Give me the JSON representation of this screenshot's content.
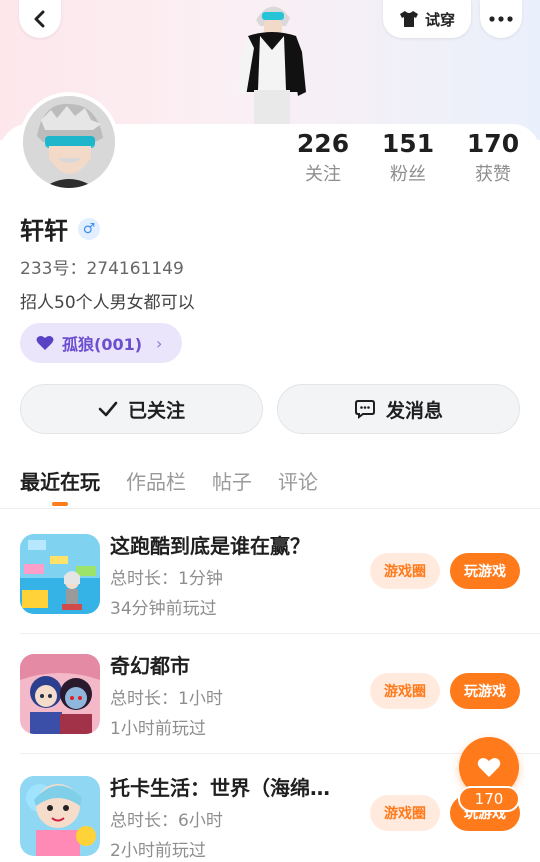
{
  "header": {
    "tryon_label": "试穿"
  },
  "profile": {
    "username": "轩轩",
    "gender_symbol": "♂",
    "uid": "233号：274161149",
    "bio": "招人50个人男女都可以",
    "guild_label": "孤狼(001)"
  },
  "stats": [
    {
      "value": "226",
      "label": "关注"
    },
    {
      "value": "151",
      "label": "粉丝"
    },
    {
      "value": "170",
      "label": "获赞"
    }
  ],
  "actions": {
    "follow_label": "已关注",
    "message_label": "发消息"
  },
  "tabs": [
    {
      "label": "最近在玩",
      "active": true
    },
    {
      "label": "作品栏",
      "active": false
    },
    {
      "label": "帖子",
      "active": false
    },
    {
      "label": "评论",
      "active": false
    }
  ],
  "games": [
    {
      "title": "这跑酷到底是谁在赢？",
      "duration": "总时长：1分钟",
      "last_played": "34分钟前玩过",
      "circle_label": "游戏圈",
      "play_label": "玩游戏"
    },
    {
      "title": "奇幻都市",
      "duration": "总时长：1小时",
      "last_played": "1小时前玩过",
      "circle_label": "游戏圈",
      "play_label": "玩游戏"
    },
    {
      "title": "托卡生活：世界（海绵…",
      "duration": "总时长：6小时",
      "last_played": "2小时前玩过",
      "circle_label": "游戏圈",
      "play_label": "玩游戏"
    }
  ],
  "like_fab": {
    "count": "170"
  },
  "colors": {
    "accent": "#ff7a1a",
    "guild_bg": "#ebe5fb",
    "guild_text": "#6b4fcf"
  }
}
